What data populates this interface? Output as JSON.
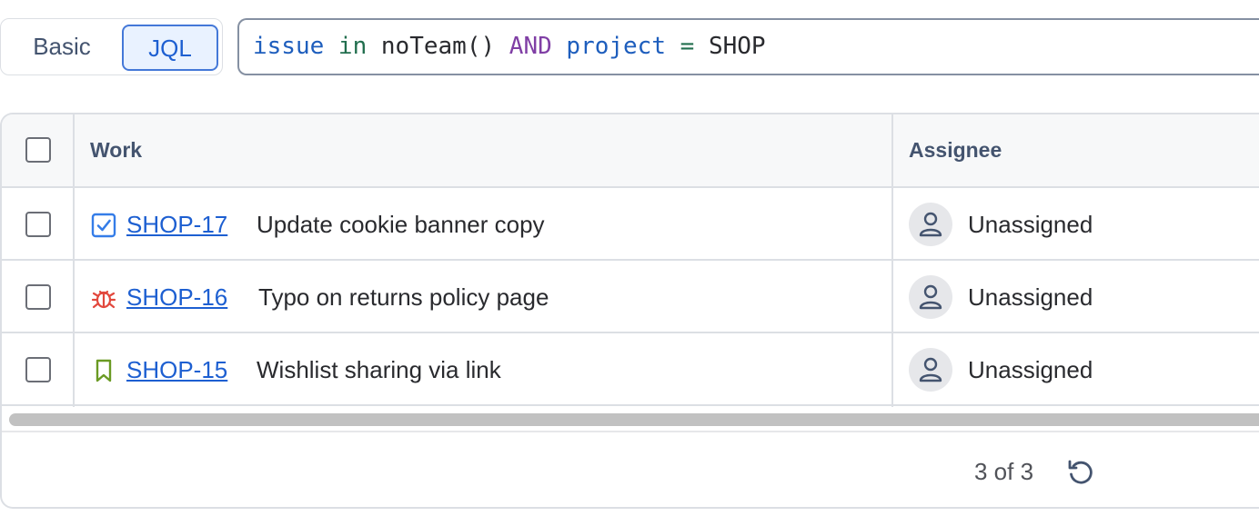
{
  "search_mode": {
    "options": [
      "Basic",
      "JQL"
    ],
    "selected": "JQL"
  },
  "jql": {
    "tokens": [
      {
        "text": "issue",
        "kind": "field"
      },
      {
        "text": " in",
        "kind": "op"
      },
      {
        "text": " noTeam()",
        "kind": "fn"
      },
      {
        "text": " AND",
        "kind": "kw"
      },
      {
        "text": " project",
        "kind": "field"
      },
      {
        "text": " =",
        "kind": "eq"
      },
      {
        "text": " SHOP",
        "kind": "val"
      }
    ]
  },
  "table": {
    "columns": [
      "Work",
      "Assignee"
    ],
    "rows": [
      {
        "type": "task",
        "type_icon": "task-checkbox-icon",
        "key": "SHOP-17",
        "summary": "Update cookie banner copy",
        "assignee": "Unassigned"
      },
      {
        "type": "bug",
        "type_icon": "bug-icon",
        "key": "SHOP-16",
        "summary": "Typo on returns policy page",
        "assignee": "Unassigned"
      },
      {
        "type": "story",
        "type_icon": "bookmark-icon",
        "key": "SHOP-15",
        "summary": "Wishlist sharing via link",
        "assignee": "Unassigned"
      }
    ]
  },
  "footer": {
    "count": "3 of 3",
    "refresh_icon": "refresh-icon"
  },
  "colors": {
    "link": "#1d5fd1",
    "task": "#357de8",
    "bug": "#e2483d",
    "story": "#6a9a23",
    "selected_bg": "#e9f2ff"
  }
}
